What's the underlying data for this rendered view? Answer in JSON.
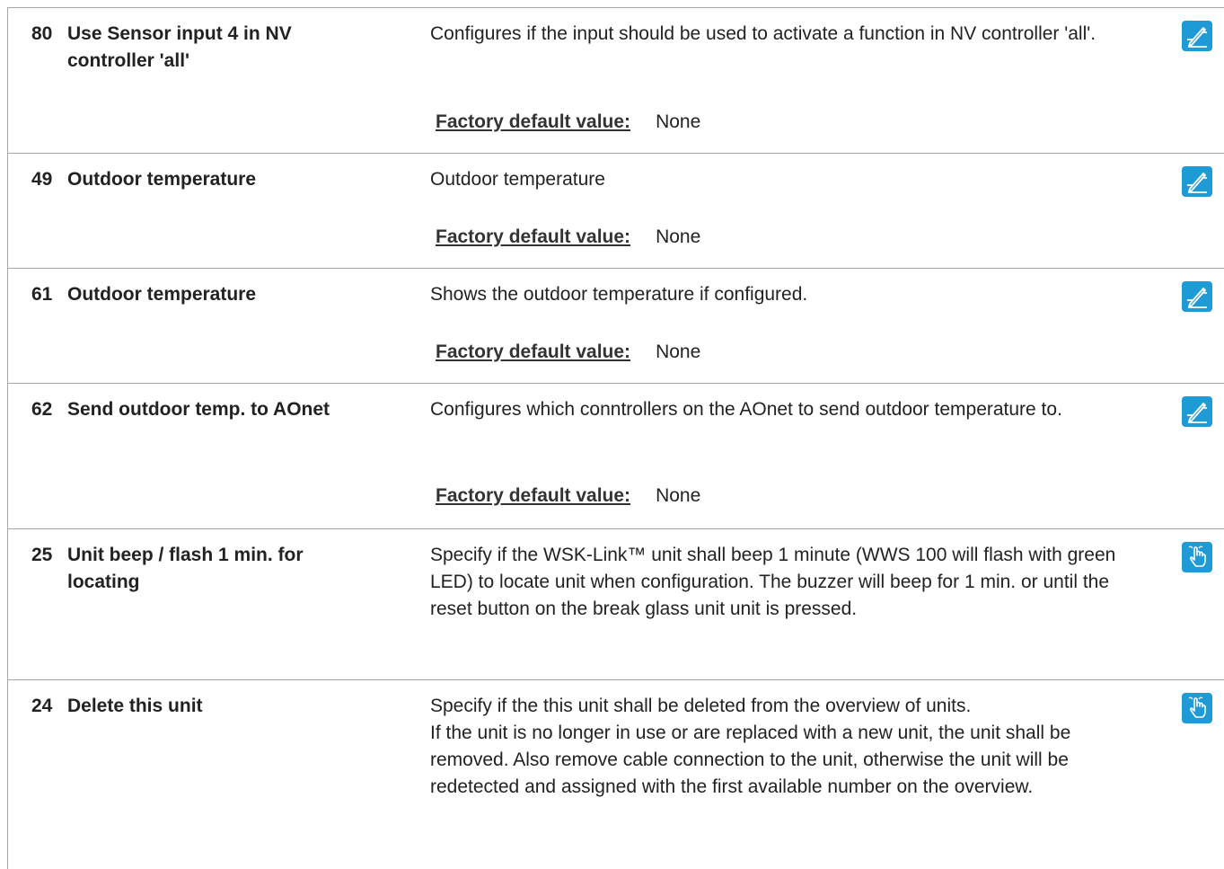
{
  "rows": [
    {
      "number": "80",
      "name": "Use Sensor input 4 in NV controller 'all'",
      "description": [
        "Configures if the input should be used to activate a function in NV controller 'all'."
      ],
      "factory_label": "Factory default value:",
      "factory_value": "None",
      "icon": "edit-icon"
    },
    {
      "number": "49",
      "name": "Outdoor temperature",
      "description": [
        "Outdoor temperature"
      ],
      "factory_label": "Factory default value:",
      "factory_value": "None",
      "icon": "edit-icon"
    },
    {
      "number": "61",
      "name": "Outdoor temperature",
      "description": [
        "Shows the outdoor temperature if configured."
      ],
      "factory_label": "Factory default value:",
      "factory_value": "None",
      "icon": "edit-icon"
    },
    {
      "number": "62",
      "name": "Send outdoor temp. to AOnet",
      "description": [
        "Configures which conntrollers on the AOnet to send outdoor temperature to."
      ],
      "factory_label": "Factory default value:",
      "factory_value": "None",
      "icon": "edit-icon"
    },
    {
      "number": "25",
      "name": "Unit beep / flash 1 min. for locating",
      "description": [
        "Specify if the WSK-Link™ unit shall beep 1 minute (WWS 100 will flash with green LED) to locate unit when configuration. The buzzer will beep for 1 min. or until the reset button on the break glass unit unit is pressed."
      ],
      "icon": "hand-pointer-icon"
    },
    {
      "number": "24",
      "name": "Delete this unit",
      "description": [
        "Specify if the this unit shall be deleted from the overview of units.",
        "If the unit is no longer in use or are replaced with a new unit, the unit shall be removed. Also remove cable connection to the unit, otherwise the unit will be redetected and assigned with the first available number on the overview."
      ],
      "icon": "hand-pointer-icon"
    }
  ]
}
